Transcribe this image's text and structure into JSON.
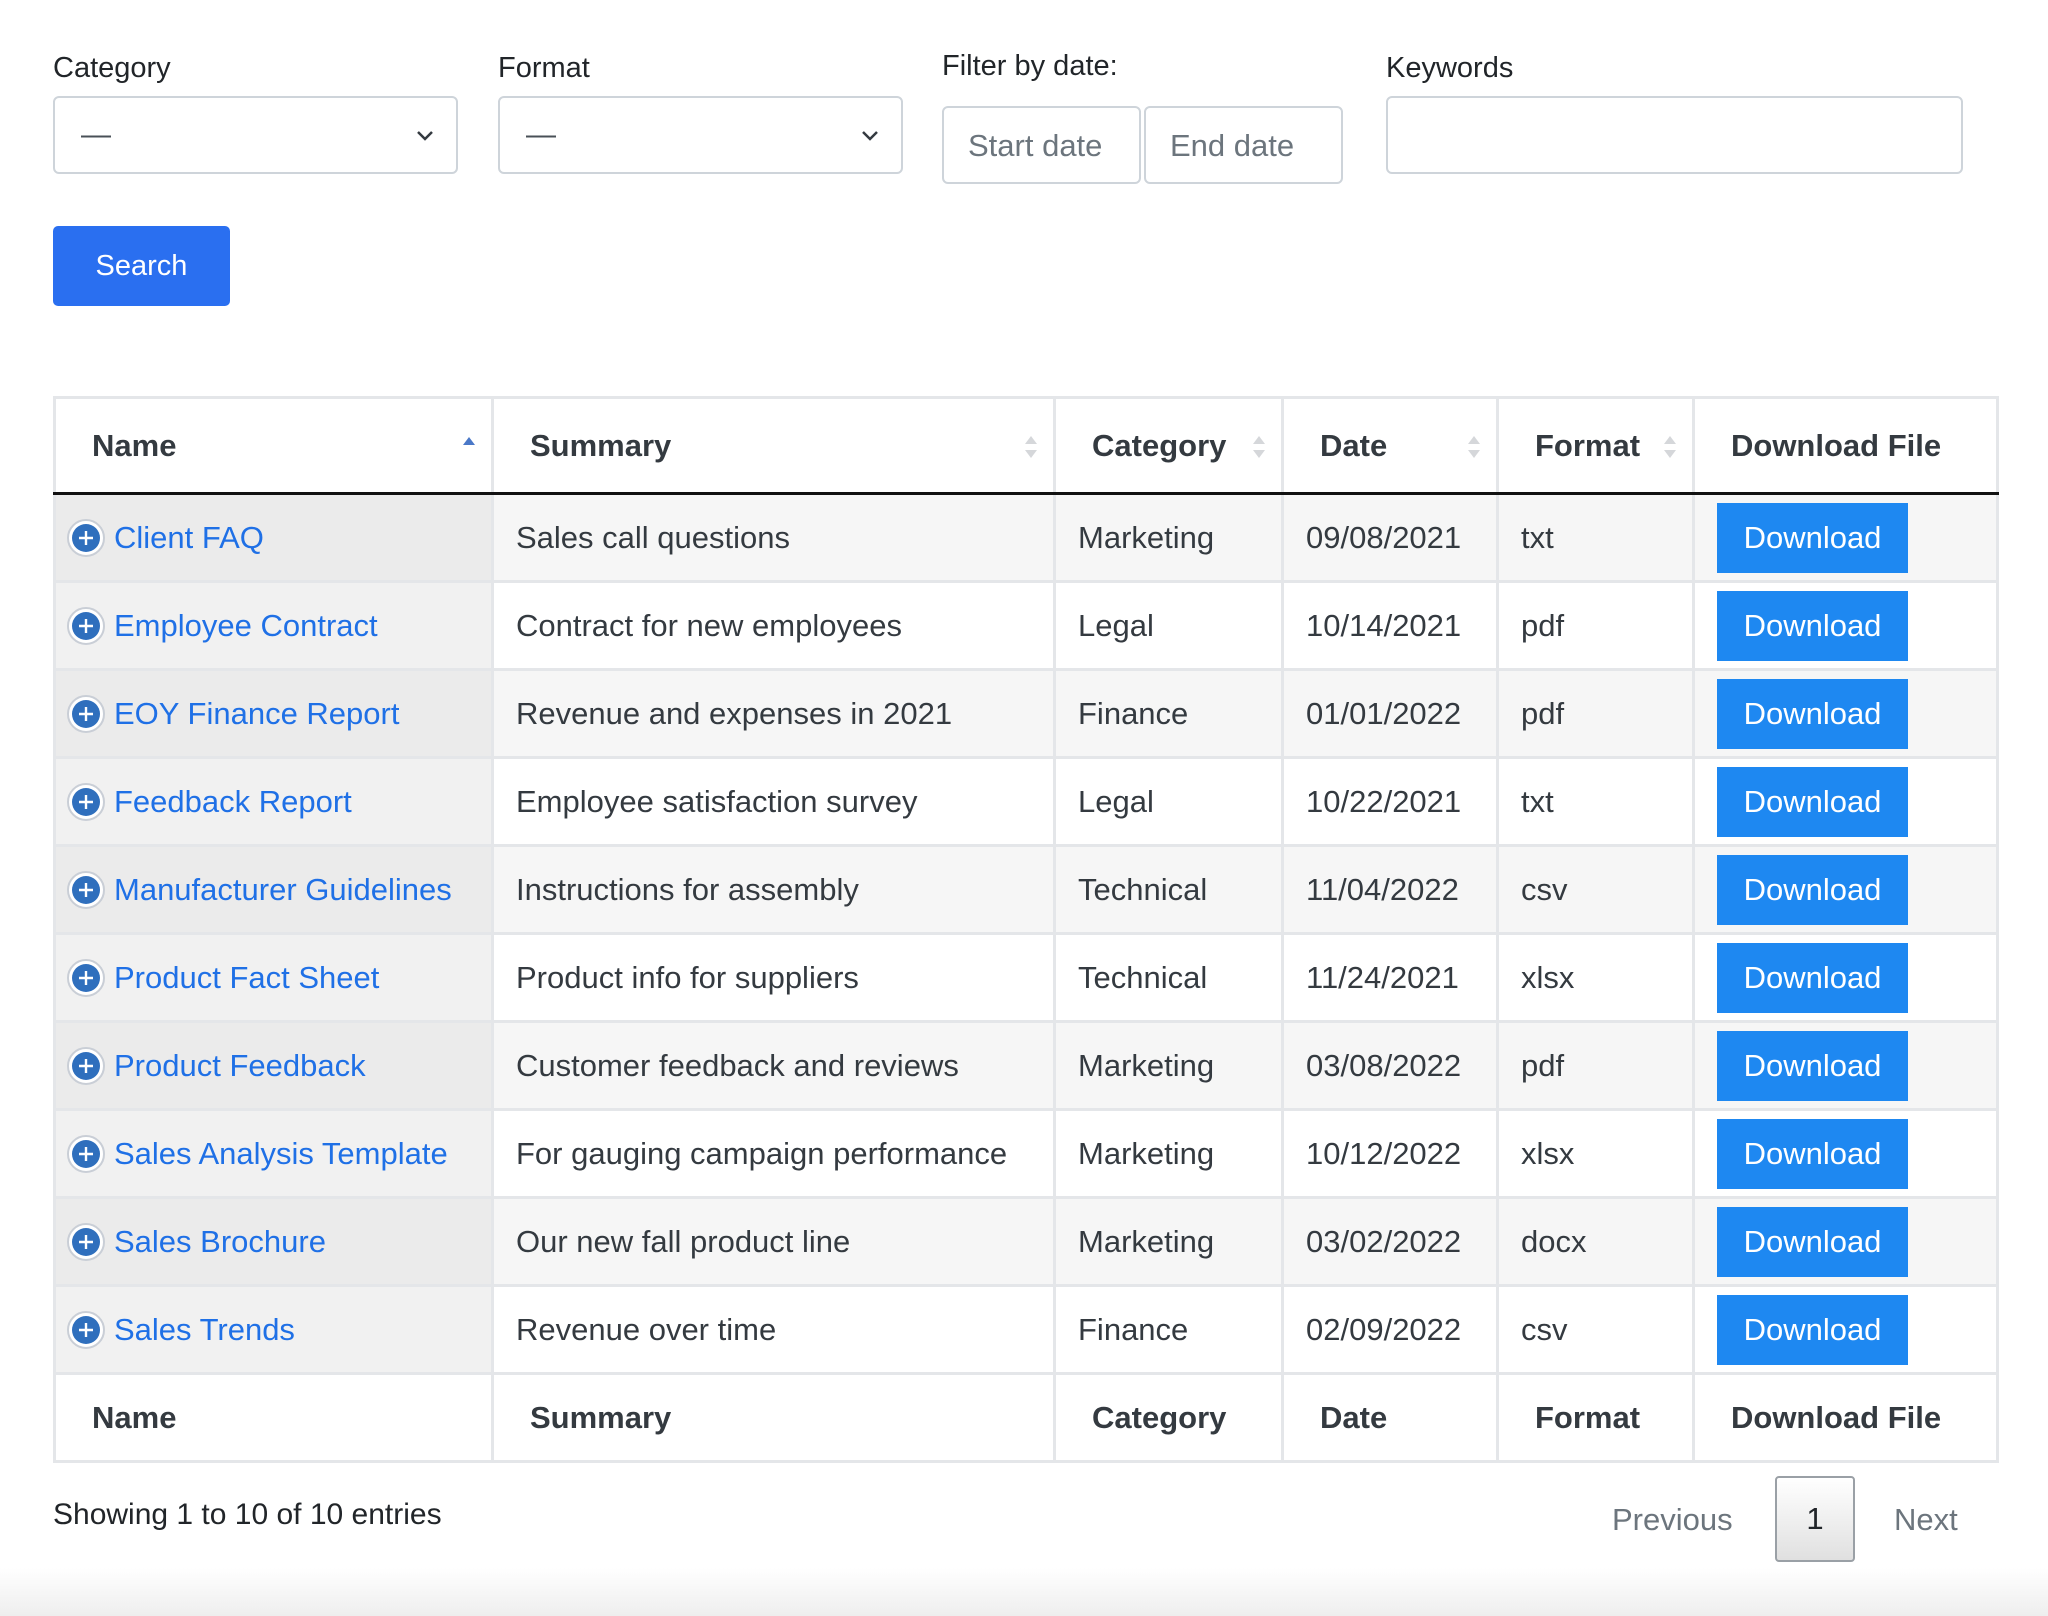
{
  "filters": {
    "category": {
      "label": "Category",
      "value": "—"
    },
    "format": {
      "label": "Format",
      "value": "—"
    },
    "date": {
      "label": "Filter by date:",
      "start_placeholder": "Start date",
      "end_placeholder": "End date"
    },
    "keywords": {
      "label": "Keywords",
      "value": ""
    },
    "search_label": "Search"
  },
  "table": {
    "columns": [
      "Name",
      "Summary",
      "Category",
      "Date",
      "Format",
      "Download File"
    ],
    "rows": [
      {
        "name": "Client FAQ",
        "summary": "Sales call questions",
        "category": "Marketing",
        "date": "09/08/2021",
        "format": "txt",
        "download": "Download"
      },
      {
        "name": "Employee Contract",
        "summary": "Contract for new employees",
        "category": "Legal",
        "date": "10/14/2021",
        "format": "pdf",
        "download": "Download"
      },
      {
        "name": "EOY Finance Report",
        "summary": "Revenue and expenses in 2021",
        "category": "Finance",
        "date": "01/01/2022",
        "format": "pdf",
        "download": "Download"
      },
      {
        "name": "Feedback Report",
        "summary": "Employee satisfaction survey",
        "category": "Legal",
        "date": "10/22/2021",
        "format": "txt",
        "download": "Download"
      },
      {
        "name": "Manufacturer Guidelines",
        "summary": "Instructions for assembly",
        "category": "Technical",
        "date": "11/04/2022",
        "format": "csv",
        "download": "Download"
      },
      {
        "name": "Product Fact Sheet",
        "summary": "Product info for suppliers",
        "category": "Technical",
        "date": "11/24/2021",
        "format": "xlsx",
        "download": "Download"
      },
      {
        "name": "Product Feedback",
        "summary": "Customer feedback and reviews",
        "category": "Marketing",
        "date": "03/08/2022",
        "format": "pdf",
        "download": "Download"
      },
      {
        "name": "Sales Analysis Template",
        "summary": "For gauging campaign performance",
        "category": "Marketing",
        "date": "10/12/2022",
        "format": "xlsx",
        "download": "Download"
      },
      {
        "name": "Sales Brochure",
        "summary": "Our new fall product line",
        "category": "Marketing",
        "date": "03/02/2022",
        "format": "docx",
        "download": "Download"
      },
      {
        "name": "Sales Trends",
        "summary": "Revenue over time",
        "category": "Finance",
        "date": "02/09/2022",
        "format": "csv",
        "download": "Download"
      }
    ],
    "sort": {
      "column": "Name",
      "direction": "ascending"
    }
  },
  "footer": {
    "info": "Showing 1 to 10 of 10 entries",
    "previous": "Previous",
    "page": "1",
    "next": "Next"
  },
  "colors": {
    "accent": "#2a6ff0",
    "download_button": "#1e88f1",
    "link": "#1f70e6",
    "expand_icon": "#2f6fbd"
  },
  "icons": [
    "chevron-down-icon",
    "sort-icon",
    "sort-asc-icon",
    "expand-plus-icon"
  ]
}
